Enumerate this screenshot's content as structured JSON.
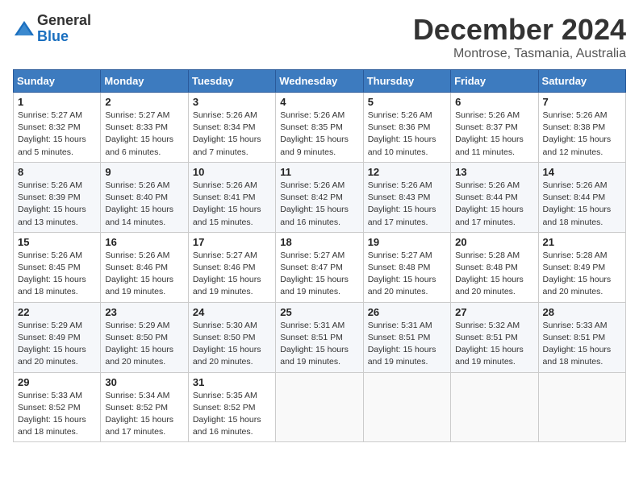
{
  "logo": {
    "general": "General",
    "blue": "Blue"
  },
  "title": "December 2024",
  "subtitle": "Montrose, Tasmania, Australia",
  "days_header": [
    "Sunday",
    "Monday",
    "Tuesday",
    "Wednesday",
    "Thursday",
    "Friday",
    "Saturday"
  ],
  "weeks": [
    [
      {
        "day": "1",
        "sunrise": "Sunrise: 5:27 AM",
        "sunset": "Sunset: 8:32 PM",
        "daylight": "Daylight: 15 hours and 5 minutes."
      },
      {
        "day": "2",
        "sunrise": "Sunrise: 5:27 AM",
        "sunset": "Sunset: 8:33 PM",
        "daylight": "Daylight: 15 hours and 6 minutes."
      },
      {
        "day": "3",
        "sunrise": "Sunrise: 5:26 AM",
        "sunset": "Sunset: 8:34 PM",
        "daylight": "Daylight: 15 hours and 7 minutes."
      },
      {
        "day": "4",
        "sunrise": "Sunrise: 5:26 AM",
        "sunset": "Sunset: 8:35 PM",
        "daylight": "Daylight: 15 hours and 9 minutes."
      },
      {
        "day": "5",
        "sunrise": "Sunrise: 5:26 AM",
        "sunset": "Sunset: 8:36 PM",
        "daylight": "Daylight: 15 hours and 10 minutes."
      },
      {
        "day": "6",
        "sunrise": "Sunrise: 5:26 AM",
        "sunset": "Sunset: 8:37 PM",
        "daylight": "Daylight: 15 hours and 11 minutes."
      },
      {
        "day": "7",
        "sunrise": "Sunrise: 5:26 AM",
        "sunset": "Sunset: 8:38 PM",
        "daylight": "Daylight: 15 hours and 12 minutes."
      }
    ],
    [
      {
        "day": "8",
        "sunrise": "Sunrise: 5:26 AM",
        "sunset": "Sunset: 8:39 PM",
        "daylight": "Daylight: 15 hours and 13 minutes."
      },
      {
        "day": "9",
        "sunrise": "Sunrise: 5:26 AM",
        "sunset": "Sunset: 8:40 PM",
        "daylight": "Daylight: 15 hours and 14 minutes."
      },
      {
        "day": "10",
        "sunrise": "Sunrise: 5:26 AM",
        "sunset": "Sunset: 8:41 PM",
        "daylight": "Daylight: 15 hours and 15 minutes."
      },
      {
        "day": "11",
        "sunrise": "Sunrise: 5:26 AM",
        "sunset": "Sunset: 8:42 PM",
        "daylight": "Daylight: 15 hours and 16 minutes."
      },
      {
        "day": "12",
        "sunrise": "Sunrise: 5:26 AM",
        "sunset": "Sunset: 8:43 PM",
        "daylight": "Daylight: 15 hours and 17 minutes."
      },
      {
        "day": "13",
        "sunrise": "Sunrise: 5:26 AM",
        "sunset": "Sunset: 8:44 PM",
        "daylight": "Daylight: 15 hours and 17 minutes."
      },
      {
        "day": "14",
        "sunrise": "Sunrise: 5:26 AM",
        "sunset": "Sunset: 8:44 PM",
        "daylight": "Daylight: 15 hours and 18 minutes."
      }
    ],
    [
      {
        "day": "15",
        "sunrise": "Sunrise: 5:26 AM",
        "sunset": "Sunset: 8:45 PM",
        "daylight": "Daylight: 15 hours and 18 minutes."
      },
      {
        "day": "16",
        "sunrise": "Sunrise: 5:26 AM",
        "sunset": "Sunset: 8:46 PM",
        "daylight": "Daylight: 15 hours and 19 minutes."
      },
      {
        "day": "17",
        "sunrise": "Sunrise: 5:27 AM",
        "sunset": "Sunset: 8:46 PM",
        "daylight": "Daylight: 15 hours and 19 minutes."
      },
      {
        "day": "18",
        "sunrise": "Sunrise: 5:27 AM",
        "sunset": "Sunset: 8:47 PM",
        "daylight": "Daylight: 15 hours and 19 minutes."
      },
      {
        "day": "19",
        "sunrise": "Sunrise: 5:27 AM",
        "sunset": "Sunset: 8:48 PM",
        "daylight": "Daylight: 15 hours and 20 minutes."
      },
      {
        "day": "20",
        "sunrise": "Sunrise: 5:28 AM",
        "sunset": "Sunset: 8:48 PM",
        "daylight": "Daylight: 15 hours and 20 minutes."
      },
      {
        "day": "21",
        "sunrise": "Sunrise: 5:28 AM",
        "sunset": "Sunset: 8:49 PM",
        "daylight": "Daylight: 15 hours and 20 minutes."
      }
    ],
    [
      {
        "day": "22",
        "sunrise": "Sunrise: 5:29 AM",
        "sunset": "Sunset: 8:49 PM",
        "daylight": "Daylight: 15 hours and 20 minutes."
      },
      {
        "day": "23",
        "sunrise": "Sunrise: 5:29 AM",
        "sunset": "Sunset: 8:50 PM",
        "daylight": "Daylight: 15 hours and 20 minutes."
      },
      {
        "day": "24",
        "sunrise": "Sunrise: 5:30 AM",
        "sunset": "Sunset: 8:50 PM",
        "daylight": "Daylight: 15 hours and 20 minutes."
      },
      {
        "day": "25",
        "sunrise": "Sunrise: 5:31 AM",
        "sunset": "Sunset: 8:51 PM",
        "daylight": "Daylight: 15 hours and 19 minutes."
      },
      {
        "day": "26",
        "sunrise": "Sunrise: 5:31 AM",
        "sunset": "Sunset: 8:51 PM",
        "daylight": "Daylight: 15 hours and 19 minutes."
      },
      {
        "day": "27",
        "sunrise": "Sunrise: 5:32 AM",
        "sunset": "Sunset: 8:51 PM",
        "daylight": "Daylight: 15 hours and 19 minutes."
      },
      {
        "day": "28",
        "sunrise": "Sunrise: 5:33 AM",
        "sunset": "Sunset: 8:51 PM",
        "daylight": "Daylight: 15 hours and 18 minutes."
      }
    ],
    [
      {
        "day": "29",
        "sunrise": "Sunrise: 5:33 AM",
        "sunset": "Sunset: 8:52 PM",
        "daylight": "Daylight: 15 hours and 18 minutes."
      },
      {
        "day": "30",
        "sunrise": "Sunrise: 5:34 AM",
        "sunset": "Sunset: 8:52 PM",
        "daylight": "Daylight: 15 hours and 17 minutes."
      },
      {
        "day": "31",
        "sunrise": "Sunrise: 5:35 AM",
        "sunset": "Sunset: 8:52 PM",
        "daylight": "Daylight: 15 hours and 16 minutes."
      },
      null,
      null,
      null,
      null
    ]
  ]
}
